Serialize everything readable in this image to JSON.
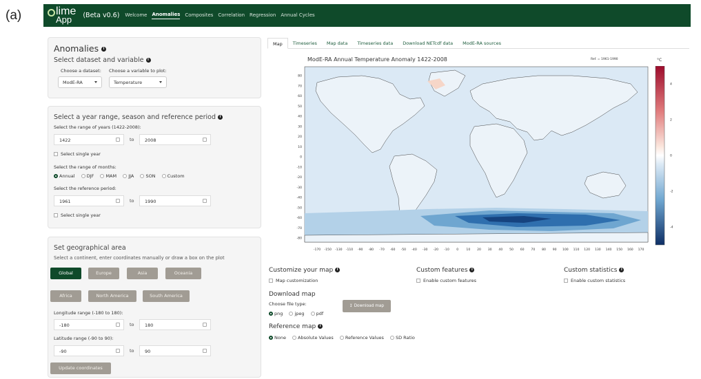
{
  "figure_label": "(a)",
  "navbar": {
    "logo_line1": "lime",
    "logo_line2": "App",
    "version": "(Beta v0.6)",
    "items": [
      "Welcome",
      "Anomalies",
      "Composites",
      "Correlation",
      "Regression",
      "Annual Cycles"
    ],
    "active_index": 1
  },
  "panel1": {
    "title": "Anomalies",
    "subtitle": "Select dataset and variable",
    "dataset_label": "Choose a dataset:",
    "dataset_value": "ModE-RA",
    "variable_label": "Choose a variable to plot:",
    "variable_value": "Temperature"
  },
  "panel2": {
    "title": "Select a year range, season and reference period",
    "years_label": "Select the range of years (1422-2008):",
    "year_from": "1422",
    "year_to": "2008",
    "to_text": "to",
    "single_year_label": "Select single year",
    "months_label": "Select the range of months:",
    "months_options": [
      "Annual",
      "DJF",
      "MAM",
      "JJA",
      "SON",
      "Custom"
    ],
    "months_selected": "Annual",
    "ref_label": "Select the reference period:",
    "ref_from": "1961",
    "ref_to": "1990",
    "ref_single_label": "Select single year"
  },
  "panel3": {
    "title": "Set geographical area",
    "subtitle": "Select a continent, enter coordinates manually or draw a box on the plot",
    "regions": [
      "Global",
      "Europe",
      "Asia",
      "Oceania",
      "Africa",
      "North America",
      "South America"
    ],
    "selected_region": "Global",
    "lon_label": "Longitude range (-180 to 180):",
    "lon_from": "-180",
    "lon_to": "180",
    "lat_label": "Latitude range (-90 to 90):",
    "lat_from": "-90",
    "lat_to": "90",
    "update_button": "Update coordinates"
  },
  "tabs": [
    "Map",
    "Timeseries",
    "Map data",
    "Timeseries data",
    "Download NETcdf data",
    "ModE-RA sources"
  ],
  "active_tab": "Map",
  "map": {
    "title": "ModE-RA Annual Temperature Anomaly 1422-2008",
    "reference": "Ref. = 1961-1990",
    "unit": "°C",
    "lat_ticks": [
      "80",
      "70",
      "60",
      "50",
      "40",
      "30",
      "20",
      "10",
      "0",
      "-10",
      "-20",
      "-30",
      "-40",
      "-50",
      "-60",
      "-70",
      "-80"
    ],
    "lon_ticks": [
      "-170",
      "-150",
      "-130",
      "-110",
      "-90",
      "-80",
      "-70",
      "-60",
      "-50",
      "-40",
      "-30",
      "-20",
      "-10",
      "0",
      "10",
      "20",
      "30",
      "40",
      "50",
      "60",
      "70",
      "80",
      "90",
      "100",
      "110",
      "120",
      "130",
      "140",
      "150",
      "160",
      "170"
    ],
    "colorbar_ticks": [
      "4",
      "2",
      "0",
      "-2",
      "-4"
    ],
    "colors": {
      "bg": "#dbe9f5",
      "land": "#ecf3f9",
      "warm": "#f6d6c8",
      "cool1": "#b3d1e8",
      "cool2": "#6fa6d0",
      "cool3": "#2f6fae",
      "cool4": "#16437f"
    }
  },
  "customize": {
    "title": "Customize your map",
    "checkbox": "Map customization",
    "features_title": "Custom features",
    "features_checkbox": "Enable custom features",
    "stats_title": "Custom statistics",
    "stats_checkbox": "Enable custom statistics"
  },
  "download": {
    "title": "Download map",
    "filetype_label": "Choose file type:",
    "types": [
      "png",
      "jpeg",
      "pdf"
    ],
    "selected": "png",
    "button": "Download map"
  },
  "reference_map": {
    "title": "Reference map",
    "options": [
      "None",
      "Absolute Values",
      "Reference Values",
      "SD Ratio"
    ],
    "selected": "None"
  }
}
